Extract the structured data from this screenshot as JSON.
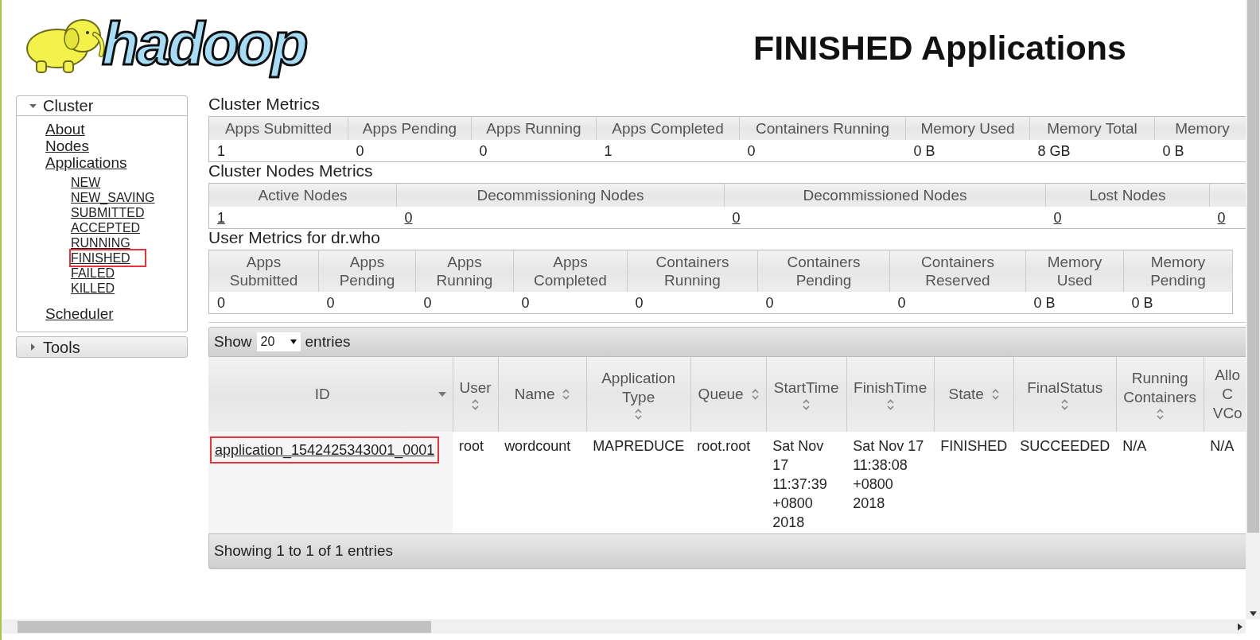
{
  "logo": {
    "text": "hadoop"
  },
  "page_title": "FINISHED Applications",
  "sidebar": [
    {
      "label": "Cluster",
      "expanded": true,
      "items": [
        {
          "label": "About",
          "highlighted": false
        },
        {
          "label": "Nodes",
          "highlighted": false
        },
        {
          "label": "Applications",
          "highlighted": false,
          "children": [
            {
              "label": "NEW",
              "highlighted": false
            },
            {
              "label": "NEW_SAVING",
              "highlighted": false
            },
            {
              "label": "SUBMITTED",
              "highlighted": false
            },
            {
              "label": "ACCEPTED",
              "highlighted": false
            },
            {
              "label": "RUNNING",
              "highlighted": false
            },
            {
              "label": "FINISHED",
              "highlighted": true
            },
            {
              "label": "FAILED",
              "highlighted": false
            },
            {
              "label": "KILLED",
              "highlighted": false
            }
          ]
        },
        {
          "label": "Scheduler",
          "highlighted": false
        }
      ]
    },
    {
      "label": "Tools",
      "expanded": false
    }
  ],
  "metrics": [
    {
      "title": "Cluster Metrics",
      "linked": false,
      "columns": [
        {
          "header": "Apps Submitted",
          "value": "1"
        },
        {
          "header": "Apps Pending",
          "value": "0"
        },
        {
          "header": "Apps Running",
          "value": "0"
        },
        {
          "header": "Apps Completed",
          "value": "1"
        },
        {
          "header": "Containers Running",
          "value": "0"
        },
        {
          "header": "Memory Used",
          "value": "0 B"
        },
        {
          "header": "Memory Total",
          "value": "8 GB"
        },
        {
          "header": "Memory",
          "value": "0 B"
        }
      ]
    },
    {
      "title": "Cluster Nodes Metrics",
      "linked": true,
      "columns": [
        {
          "header": "Active Nodes",
          "value": "1"
        },
        {
          "header": "Decommissioning Nodes",
          "value": "0"
        },
        {
          "header": "Decommissioned Nodes",
          "value": "0"
        },
        {
          "header": "Lost Nodes",
          "value": "0"
        },
        {
          "value": "0"
        }
      ]
    },
    {
      "title": "User Metrics for dr.who",
      "linked": false,
      "columns": [
        {
          "header": "Apps Submitted",
          "value": "0"
        },
        {
          "header": "Apps Pending",
          "value": "0"
        },
        {
          "header": "Apps Running",
          "value": "0"
        },
        {
          "header": "Apps Completed",
          "value": "0"
        },
        {
          "header": "Containers Running",
          "value": "0"
        },
        {
          "header": "Containers Pending",
          "value": "0"
        },
        {
          "header": "Containers Reserved",
          "value": "0"
        },
        {
          "header": "Memory Used",
          "value": "0 B"
        },
        {
          "header": "Memory Pending",
          "value": "0 B"
        }
      ]
    }
  ],
  "apps_table": {
    "length_menu": {
      "before": "Show",
      "value": "20",
      "after": "entries"
    },
    "columns": [
      {
        "header": "ID",
        "sortable": true,
        "sorted": true
      },
      {
        "header": "User",
        "sortable": true,
        "sorted": false
      },
      {
        "header": "Name",
        "sortable": true,
        "sorted": false
      },
      {
        "header": "Application Type",
        "sortable": true,
        "sorted": false
      },
      {
        "header": "Queue",
        "sortable": true,
        "sorted": false
      },
      {
        "header": "StartTime",
        "sortable": true,
        "sorted": false
      },
      {
        "header": "FinishTime",
        "sortable": true,
        "sorted": false
      },
      {
        "header": "State",
        "sortable": true,
        "sorted": false
      },
      {
        "header": "FinalStatus",
        "sortable": true,
        "sorted": false
      },
      {
        "header": "Running Containers",
        "sortable": true,
        "sorted": false
      },
      {
        "header": "Allo C VCo",
        "sortable": false,
        "sorted": false
      }
    ],
    "rows": [
      {
        "cells": [
          {
            "text": "application_1542425343001_0001",
            "link": true,
            "highlighted": true
          },
          {
            "text": "root",
            "link": false,
            "highlighted": false
          },
          {
            "text": "wordcount",
            "link": false,
            "highlighted": false
          },
          {
            "text": "MAPREDUCE",
            "link": false,
            "highlighted": false
          },
          {
            "text": "root.root",
            "link": false,
            "highlighted": false
          },
          {
            "text": "Sat Nov 17 11:37:39 +0800 2018",
            "link": false,
            "highlighted": false
          },
          {
            "text": "Sat Nov 17 11:38:08 +0800 2018",
            "link": false,
            "highlighted": false
          },
          {
            "text": "FINISHED",
            "link": false,
            "highlighted": false
          },
          {
            "text": "SUCCEEDED",
            "link": false,
            "highlighted": false
          },
          {
            "text": "N/A",
            "link": false,
            "highlighted": false
          },
          {
            "text": "N/A",
            "link": false,
            "highlighted": false
          }
        ]
      }
    ],
    "info": "Showing 1 to 1 of 1 entries"
  }
}
